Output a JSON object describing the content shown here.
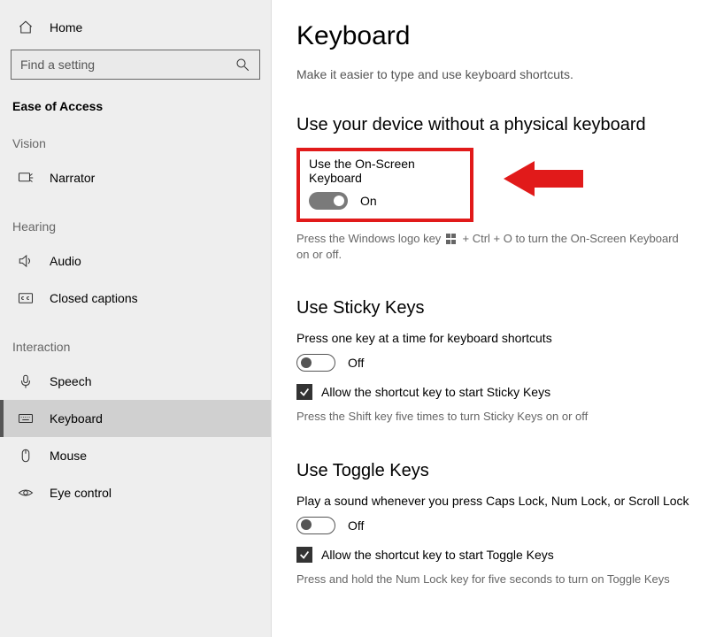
{
  "sidebar": {
    "home": "Home",
    "search_placeholder": "Find a setting",
    "category": "Ease of Access",
    "groups": {
      "vision": {
        "label": "Vision",
        "items": {
          "narrator": "Narrator"
        }
      },
      "hearing": {
        "label": "Hearing",
        "items": {
          "audio": "Audio",
          "closed_captions": "Closed captions"
        }
      },
      "interaction": {
        "label": "Interaction",
        "items": {
          "speech": "Speech",
          "keyboard": "Keyboard",
          "mouse": "Mouse",
          "eye_control": "Eye control"
        }
      }
    }
  },
  "page": {
    "title": "Keyboard",
    "subtitle": "Make it easier to type and use keyboard shortcuts.",
    "onscreen": {
      "heading": "Use your device without a physical keyboard",
      "label": "Use the On-Screen Keyboard",
      "state": "On",
      "hint_pre": "Press the Windows logo key ",
      "hint_post": " + Ctrl + O to turn the On-Screen Keyboard on or off."
    },
    "sticky": {
      "heading": "Use Sticky Keys",
      "desc": "Press one key at a time for keyboard shortcuts",
      "state": "Off",
      "checkbox": "Allow the shortcut key to start Sticky Keys",
      "hint": "Press the Shift key five times to turn Sticky Keys on or off"
    },
    "toggle": {
      "heading": "Use Toggle Keys",
      "desc": "Play a sound whenever you press Caps Lock, Num Lock, or Scroll Lock",
      "state": "Off",
      "checkbox": "Allow the shortcut key to start Toggle Keys",
      "hint": "Press and hold the Num Lock key for five seconds to turn on Toggle Keys"
    }
  }
}
